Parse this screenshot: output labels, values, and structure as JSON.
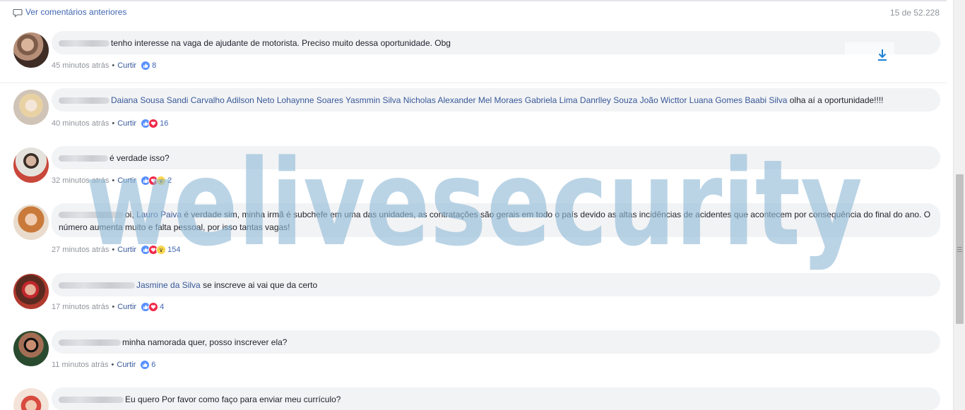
{
  "header": {
    "prev_comments_label": "Ver comentários anteriores",
    "count_label": "15 de 52.228"
  },
  "like_label": "Curtir",
  "comments": [
    {
      "author_blurred": true,
      "text": "tenho interesse na vaga de ajudante de motorista. Preciso muito dessa oportunidade. Obg",
      "time": "45 minutos atrás",
      "reactions": [
        "like"
      ],
      "reaction_count": "8"
    },
    {
      "author_blurred": true,
      "tags": "Daiana Sousa Sandi Carvalho Adilson Neto Lohaynne Soares Yasmmin Silva Nicholas Alexander Mel Moraes Gabriela Lima Danrlley Souza João Wicttor Luana Gomes Baabi Silva",
      "text": "olha aí a oportunidade!!!!",
      "time": "40 minutos atrás",
      "reactions": [
        "like",
        "love"
      ],
      "reaction_count": "16"
    },
    {
      "author_blurred": true,
      "text": "é verdade isso?",
      "time": "32 minutos atrás",
      "reactions": [
        "like",
        "love",
        "wow"
      ],
      "reaction_count": "2"
    },
    {
      "author_blurred": true,
      "text_a": "oi,",
      "tag": "Lauro Paiva",
      "text_b": "é verdade sim, minha irmã é subchefe em uma das unidades, as contratações são gerais em todo o país devido as altas incidências de acidentes que acontecem por consequência do final do ano. O número aumenta muito e falta pessoal, por isso tantas vagas!",
      "time": "27 minutos atrás",
      "reactions": [
        "like",
        "love",
        "wow"
      ],
      "reaction_count": "154"
    },
    {
      "author_blurred": true,
      "tag": "Jasmine da Silva",
      "text": "se inscreve ai vai que da certo",
      "time": "17 minutos atrás",
      "reactions": [
        "like",
        "love"
      ],
      "reaction_count": "4"
    },
    {
      "author_blurred": true,
      "text": "minha namorada quer, posso inscrever ela?",
      "time": "11 minutos atrás",
      "reactions": [
        "like"
      ],
      "reaction_count": "6"
    },
    {
      "author_blurred": true,
      "text": "Eu quero Por favor como faço para enviar meu currículo?"
    }
  ],
  "watermark": "welivesecurity",
  "colors": {
    "link": "#385898",
    "bubble": "#f2f3f5",
    "meta": "#90949c",
    "watermark": "#8fb9d6"
  }
}
